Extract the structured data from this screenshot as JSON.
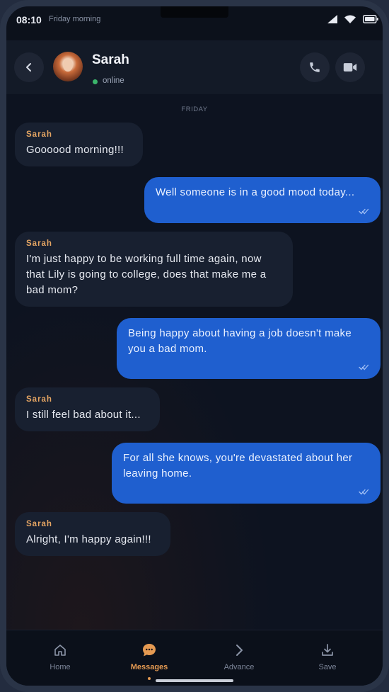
{
  "status_bar": {
    "time": "08:10",
    "day": "Friday morning"
  },
  "header": {
    "contact_name": "Sarah",
    "status": "online",
    "status_color": "#3bb56b"
  },
  "chat": {
    "day_separator": "FRIDAY",
    "messages": [
      {
        "direction": "in",
        "sender": "Sarah",
        "text": "Goooood morning!!!"
      },
      {
        "direction": "out",
        "text": "Well someone is in a good mood today...",
        "read": true
      },
      {
        "direction": "in",
        "sender": "Sarah",
        "text": "I'm just happy to be working full time again, now that Lily is going to college, does that make me a bad mom?"
      },
      {
        "direction": "out",
        "text": "Being happy about having a job doesn't make you a bad mom.",
        "read": true
      },
      {
        "direction": "in",
        "sender": "Sarah",
        "text": "I still feel bad about it..."
      },
      {
        "direction": "out",
        "text": "For all she knows, you're devastated about her leaving home.",
        "read": true
      },
      {
        "direction": "in",
        "sender": "Sarah",
        "text": "Alright, I'm happy again!!!"
      }
    ]
  },
  "nav": {
    "items": [
      {
        "label": "Home",
        "icon": "home-icon"
      },
      {
        "label": "Messages",
        "icon": "chat-bubble-icon",
        "active": true
      },
      {
        "label": "Advance",
        "icon": "chevron-right-icon"
      },
      {
        "label": "Save",
        "icon": "download-icon"
      }
    ]
  },
  "colors": {
    "accent": "#e59a52",
    "outgoing_bubble": "#1f5fcf",
    "incoming_bubble": "#182030",
    "sender_name": "#e5a563"
  }
}
